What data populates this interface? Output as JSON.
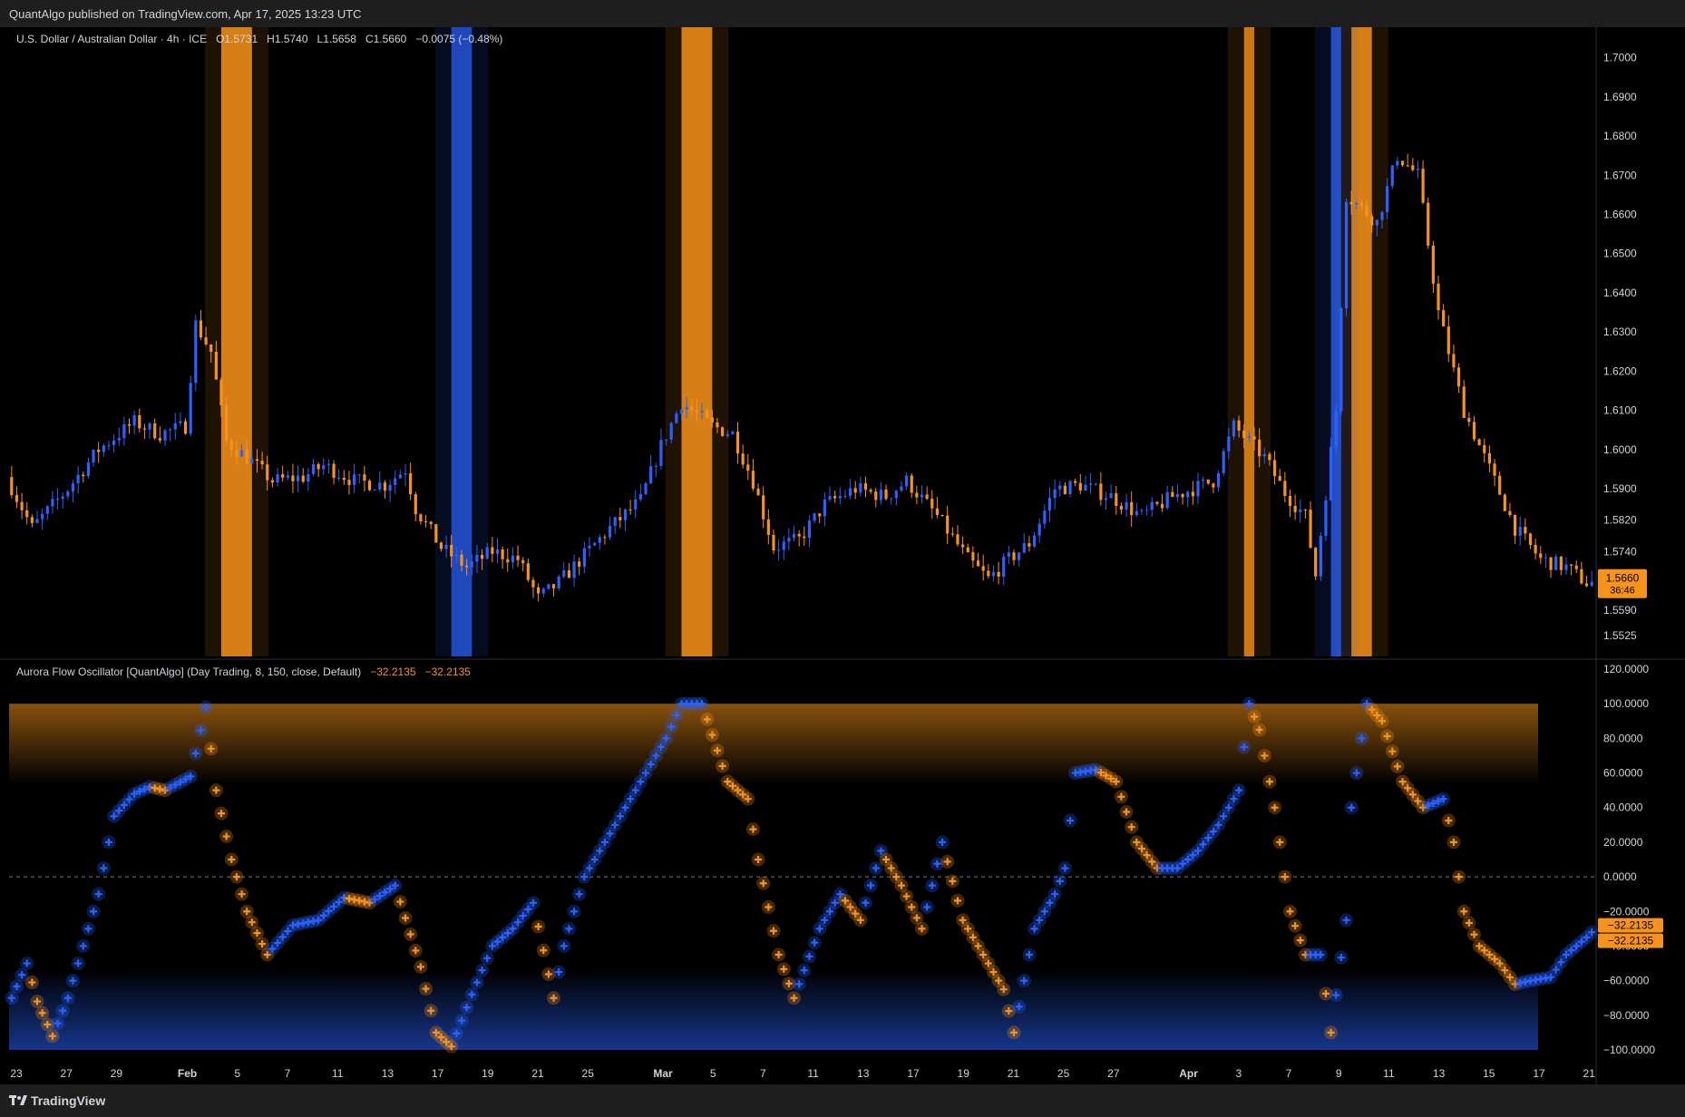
{
  "header": {
    "text": "QuantAlgo published on TradingView.com, Apr 17, 2025 13:23 UTC"
  },
  "footer": {
    "brand": "TradingView"
  },
  "colors": {
    "bull": "#2962ff",
    "bear": "#f7931a",
    "background": "#000000",
    "text": "#d1d4dc"
  },
  "price_legend": {
    "symbol": "U.S. Dollar / Australian Dollar · 4h · ICE",
    "open": "O1.5731",
    "high": "H1.5740",
    "low": "L1.5658",
    "close": "C1.5660",
    "change": "−0.0075 (−0.48%)"
  },
  "price_badge": {
    "price": "1.5660",
    "countdown": "36:46"
  },
  "osc_legend": {
    "name": "Aurora Flow Oscillator [QuantAlgo] (Day Trading, 8, 150, close, Default)",
    "value1": "−32.2135",
    "value2": "−32.2135"
  },
  "osc_badges": [
    "−32.2135",
    "−32.2135"
  ],
  "chart_data": [
    {
      "type": "candlestick",
      "price_ticks": [
        "1.7000",
        "1.6900",
        "1.6800",
        "1.6700",
        "1.6600",
        "1.6500",
        "1.6400",
        "1.6300",
        "1.6200",
        "1.6100",
        "1.6000",
        "1.5900",
        "1.5820",
        "1.5740",
        "1.5590",
        "1.5525"
      ],
      "ylim": [
        1.55,
        1.705
      ],
      "key_points": [
        [
          0,
          1.593
        ],
        [
          5,
          1.58
        ],
        [
          12,
          1.59
        ],
        [
          18,
          1.6
        ],
        [
          25,
          1.607
        ],
        [
          30,
          1.604
        ],
        [
          35,
          1.606
        ],
        [
          37,
          1.632
        ],
        [
          40,
          1.625
        ],
        [
          43,
          1.602
        ],
        [
          47,
          1.598
        ],
        [
          52,
          1.592
        ],
        [
          58,
          1.593
        ],
        [
          62,
          1.596
        ],
        [
          68,
          1.592
        ],
        [
          74,
          1.591
        ],
        [
          78,
          1.595
        ],
        [
          80,
          1.585
        ],
        [
          85,
          1.575
        ],
        [
          90,
          1.57
        ],
        [
          95,
          1.574
        ],
        [
          100,
          1.572
        ],
        [
          104,
          1.562
        ],
        [
          108,
          1.566
        ],
        [
          113,
          1.573
        ],
        [
          118,
          1.58
        ],
        [
          124,
          1.587
        ],
        [
          128,
          1.601
        ],
        [
          132,
          1.612
        ],
        [
          138,
          1.606
        ],
        [
          142,
          1.604
        ],
        [
          146,
          1.592
        ],
        [
          150,
          1.575
        ],
        [
          155,
          1.577
        ],
        [
          160,
          1.586
        ],
        [
          166,
          1.59
        ],
        [
          172,
          1.588
        ],
        [
          176,
          1.592
        ],
        [
          182,
          1.583
        ],
        [
          188,
          1.572
        ],
        [
          192,
          1.567
        ],
        [
          196,
          1.572
        ],
        [
          200,
          1.576
        ],
        [
          205,
          1.59
        ],
        [
          210,
          1.591
        ],
        [
          216,
          1.588
        ],
        [
          222,
          1.583
        ],
        [
          228,
          1.588
        ],
        [
          236,
          1.592
        ],
        [
          240,
          1.606
        ],
        [
          246,
          1.598
        ],
        [
          250,
          1.589
        ],
        [
          254,
          1.583
        ],
        [
          256,
          1.568
        ],
        [
          260,
          1.61
        ],
        [
          262,
          1.665
        ],
        [
          268,
          1.658
        ],
        [
          272,
          1.675
        ],
        [
          276,
          1.67
        ],
        [
          280,
          1.635
        ],
        [
          285,
          1.61
        ],
        [
          290,
          1.595
        ],
        [
          295,
          1.58
        ],
        [
          300,
          1.572
        ],
        [
          305,
          1.57
        ],
        [
          309,
          1.566
        ]
      ],
      "highlight_bands": [
        {
          "from": 41,
          "to": 47,
          "color": "#f7931a",
          "opacity": 0.85
        },
        {
          "from": 131,
          "to": 137,
          "color": "#f7931a",
          "opacity": 0.85
        },
        {
          "from": 241,
          "to": 243,
          "color": "#f7931a",
          "opacity": 0.8
        },
        {
          "from": 262,
          "to": 266,
          "color": "#f7931a",
          "opacity": 0.85
        },
        {
          "from": 86,
          "to": 90,
          "color": "#2962ff",
          "opacity": 0.7
        },
        {
          "from": 258,
          "to": 260,
          "color": "#2962ff",
          "opacity": 0.75
        }
      ]
    },
    {
      "type": "scatter",
      "name": "Aurora Flow Oscillator",
      "osc_ticks": [
        "120.0000",
        "100.0000",
        "80.0000",
        "60.0000",
        "40.0000",
        "20.0000",
        "0.0000",
        "−20.0000",
        "−40.0000",
        "−60.0000",
        "−80.0000",
        "−100.0000"
      ],
      "ylim": [
        -100,
        120
      ],
      "overbought_zone": [
        55,
        100
      ],
      "oversold_zone": [
        -100,
        -55
      ],
      "zero_line": 0,
      "key_points": [
        [
          0,
          -70
        ],
        [
          3,
          -50
        ],
        [
          5,
          -72
        ],
        [
          8,
          -92
        ],
        [
          11,
          -70
        ],
        [
          14,
          -40
        ],
        [
          17,
          -10
        ],
        [
          20,
          35
        ],
        [
          24,
          48
        ],
        [
          27,
          52
        ],
        [
          30,
          50
        ],
        [
          35,
          58
        ],
        [
          38,
          98
        ],
        [
          40,
          50
        ],
        [
          43,
          10
        ],
        [
          46,
          -20
        ],
        [
          50,
          -45
        ],
        [
          55,
          -28
        ],
        [
          60,
          -25
        ],
        [
          65,
          -12
        ],
        [
          70,
          -15
        ],
        [
          75,
          -5
        ],
        [
          80,
          -52
        ],
        [
          83,
          -90
        ],
        [
          86,
          -98
        ],
        [
          90,
          -68
        ],
        [
          94,
          -40
        ],
        [
          98,
          -30
        ],
        [
          102,
          -15
        ],
        [
          106,
          -70
        ],
        [
          108,
          -40
        ],
        [
          112,
          0
        ],
        [
          116,
          20
        ],
        [
          120,
          40
        ],
        [
          124,
          60
        ],
        [
          128,
          80
        ],
        [
          131,
          100
        ],
        [
          135,
          100
        ],
        [
          140,
          55
        ],
        [
          144,
          45
        ],
        [
          146,
          10
        ],
        [
          150,
          -45
        ],
        [
          153,
          -70
        ],
        [
          158,
          -30
        ],
        [
          162,
          -10
        ],
        [
          166,
          -25
        ],
        [
          170,
          15
        ],
        [
          174,
          -5
        ],
        [
          178,
          -30
        ],
        [
          182,
          20
        ],
        [
          186,
          -25
        ],
        [
          190,
          -45
        ],
        [
          194,
          -65
        ],
        [
          196,
          -90
        ],
        [
          200,
          -30
        ],
        [
          204,
          -10
        ],
        [
          206,
          5
        ],
        [
          208,
          60
        ],
        [
          212,
          62
        ],
        [
          216,
          55
        ],
        [
          220,
          20
        ],
        [
          224,
          5
        ],
        [
          228,
          5
        ],
        [
          232,
          15
        ],
        [
          236,
          30
        ],
        [
          240,
          50
        ],
        [
          242,
          100
        ],
        [
          244,
          85
        ],
        [
          247,
          40
        ],
        [
          250,
          -20
        ],
        [
          253,
          -45
        ],
        [
          256,
          -45
        ],
        [
          258,
          -90
        ],
        [
          261,
          -25
        ],
        [
          262,
          40
        ],
        [
          265,
          100
        ],
        [
          268,
          90
        ],
        [
          272,
          55
        ],
        [
          276,
          40
        ],
        [
          280,
          45
        ],
        [
          282,
          20
        ],
        [
          284,
          -20
        ],
        [
          287,
          -40
        ],
        [
          291,
          -50
        ],
        [
          294,
          -62
        ],
        [
          297,
          -60
        ],
        [
          301,
          -58
        ],
        [
          304,
          -45
        ],
        [
          308,
          -35
        ],
        [
          309,
          -32
        ]
      ]
    }
  ],
  "x_ticks": [
    {
      "label": "23",
      "i": 0
    },
    {
      "label": "27",
      "i": 12
    },
    {
      "label": "29",
      "i": 24
    },
    {
      "label": "Feb",
      "i": 41
    },
    {
      "label": "5",
      "i": 53
    },
    {
      "label": "7",
      "i": 65
    },
    {
      "label": "11",
      "i": 77
    },
    {
      "label": "13",
      "i": 89
    },
    {
      "label": "17",
      "i": 101
    },
    {
      "label": "19",
      "i": 113
    },
    {
      "label": "21",
      "i": 125
    },
    {
      "label": "25",
      "i": 137
    },
    {
      "label": "Mar",
      "i": 155
    },
    {
      "label": "5",
      "i": 167
    },
    {
      "label": "7",
      "i": 179
    },
    {
      "label": "11",
      "i": 191
    },
    {
      "label": "13",
      "i": 203
    },
    {
      "label": "17",
      "i": 215
    },
    {
      "label": "19",
      "i": 227
    },
    {
      "label": "21",
      "i": 239
    },
    {
      "label": "25",
      "i": 251
    },
    {
      "label": "27",
      "i": 263
    },
    {
      "label": "Apr",
      "i": 281
    },
    {
      "label": "3",
      "i": 293
    },
    {
      "label": "7",
      "i": 305
    },
    {
      "label": "9",
      "i": 317
    },
    {
      "label": "11",
      "i": 329
    },
    {
      "label": "13",
      "i": 341
    },
    {
      "label": "15",
      "i": 353
    },
    {
      "label": "17",
      "i": 365
    },
    {
      "label": "21",
      "i": 377
    }
  ]
}
